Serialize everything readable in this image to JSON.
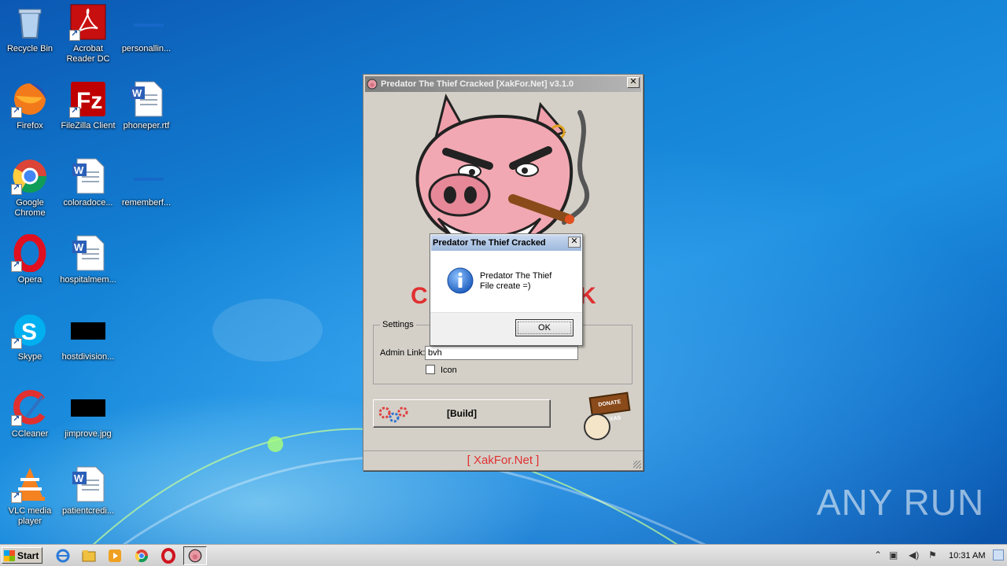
{
  "desktop": {
    "icons": [
      {
        "label": "Recycle Bin",
        "icon": "recycle-bin-icon"
      },
      {
        "label": "Acrobat Reader DC",
        "icon": "acrobat-icon"
      },
      {
        "label": "personallin...",
        "icon": "file-icon"
      },
      {
        "label": "Firefox",
        "icon": "firefox-icon"
      },
      {
        "label": "FileZilla Client",
        "icon": "filezilla-icon"
      },
      {
        "label": "phoneper.rtf",
        "icon": "word-doc-icon"
      },
      {
        "label": "Google Chrome",
        "icon": "chrome-icon"
      },
      {
        "label": "coloradoce...",
        "icon": "word-doc-icon"
      },
      {
        "label": "rememberf...",
        "icon": "file-icon"
      },
      {
        "label": "Opera",
        "icon": "opera-icon"
      },
      {
        "label": "hospitalmem...",
        "icon": "word-doc-icon"
      },
      {
        "label": "Skype",
        "icon": "skype-icon"
      },
      {
        "label": "hostdivision...",
        "icon": "image-icon"
      },
      {
        "label": "CCleaner",
        "icon": "ccleaner-icon"
      },
      {
        "label": "jimprove.jpg",
        "icon": "image-icon"
      },
      {
        "label": "VLC media player",
        "icon": "vlc-icon"
      },
      {
        "label": "patientcredi...",
        "icon": "word-doc-icon"
      }
    ]
  },
  "main_window": {
    "title": "Predator The Thief Cracked [XakFor.Net] v3.1.0",
    "settings_legend": "Settings",
    "admin_link_label": "Admin Link:",
    "admin_link_value": "bvh",
    "icon_checkbox_label": "Icon",
    "icon_checked": false,
    "build_label": "[Build]",
    "footer_link": "[ XakFor.Net ]",
    "donate_text": "DONATE TEXAS"
  },
  "dialog": {
    "title": "Predator The Thief Cracked",
    "message_line1": "Predator The Thief",
    "message_line2": "File create =)",
    "ok_label": "OK"
  },
  "taskbar": {
    "start_label": "Start",
    "clock": "10:31 AM"
  },
  "watermark": "ANY RUN"
}
